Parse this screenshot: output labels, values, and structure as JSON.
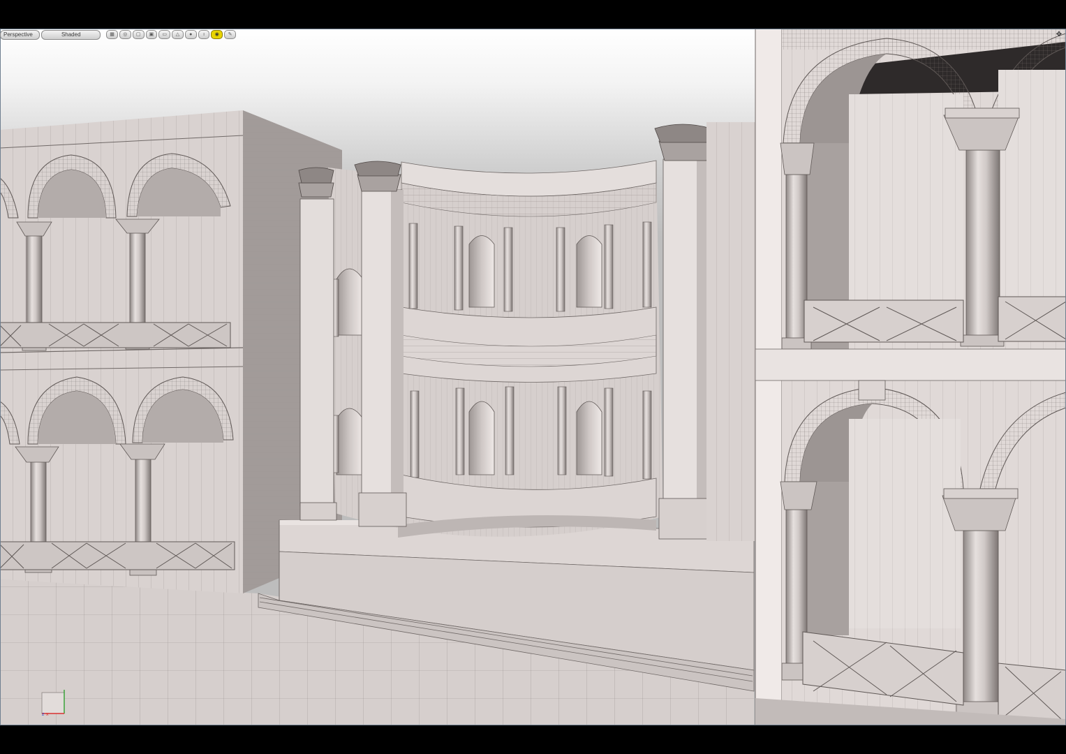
{
  "viewport": {
    "view_label": "Perspective",
    "shading_label": "Shaded",
    "toolbar_buttons": [
      {
        "icon": "grid-icon"
      },
      {
        "icon": "snap-icon"
      },
      {
        "icon": "frame-icon"
      },
      {
        "icon": "camera-icon"
      },
      {
        "icon": "display-icon"
      },
      {
        "icon": "triangle-icon"
      },
      {
        "icon": "light-icon"
      },
      {
        "icon": "info-icon"
      },
      {
        "icon": "toggle-icon",
        "active": true
      },
      {
        "icon": "wrench-icon"
      }
    ],
    "corner_icon": "maximize-icon"
  },
  "axis_gizmo": {
    "x_label": "x",
    "z_label": "z",
    "x_color": "#d83030",
    "y_color": "#2fa02f",
    "z_color": "#3050d0"
  },
  "colors": {
    "model": "#d8d1cf",
    "model_light": "#e6e0de",
    "model_shadow": "#a39c9a",
    "viewport_frame": "#6f7f90",
    "active_button": "#e8d400"
  }
}
